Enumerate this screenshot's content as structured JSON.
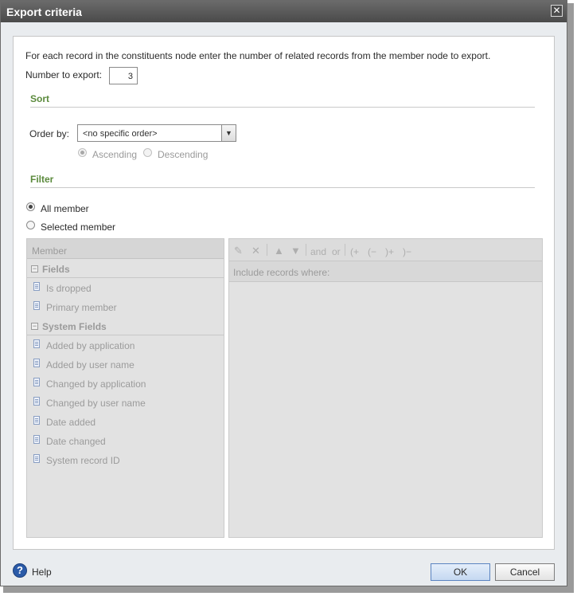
{
  "window": {
    "title": "Export criteria",
    "close_glyph": "✕"
  },
  "intro": "For each record in the constituents node enter the number of related records from the member node to export.",
  "number_to_export": {
    "label": "Number to export:",
    "value": "3"
  },
  "sort": {
    "heading": "Sort",
    "order_by_label": "Order by:",
    "order_by_value": "<no specific order>",
    "ascending_label": "Ascending",
    "descending_label": "Descending"
  },
  "filter": {
    "heading": "Filter",
    "all_label": "All member",
    "selected_label": "Selected member"
  },
  "tree": {
    "header": "Member",
    "groups": [
      {
        "label": "Fields",
        "items": [
          "Is dropped",
          "Primary member"
        ]
      },
      {
        "label": "System Fields",
        "items": [
          "Added by application",
          "Added by user name",
          "Changed by application",
          "Changed by user name",
          "Date added",
          "Date changed",
          "System record ID"
        ]
      }
    ]
  },
  "criteria": {
    "toolbar": {
      "and": "and",
      "or": "or",
      "open_plus": "(+",
      "open_minus": "(−",
      "close_plus": ")+",
      "close_minus": ")−"
    },
    "include_label": "Include records where:"
  },
  "footer": {
    "help": "Help",
    "ok": "OK",
    "cancel": "Cancel"
  },
  "colors": {
    "section_heading": "#5b8a3c",
    "titlebar": "#5a5a5a",
    "help_icon": "#2a5aa8"
  }
}
